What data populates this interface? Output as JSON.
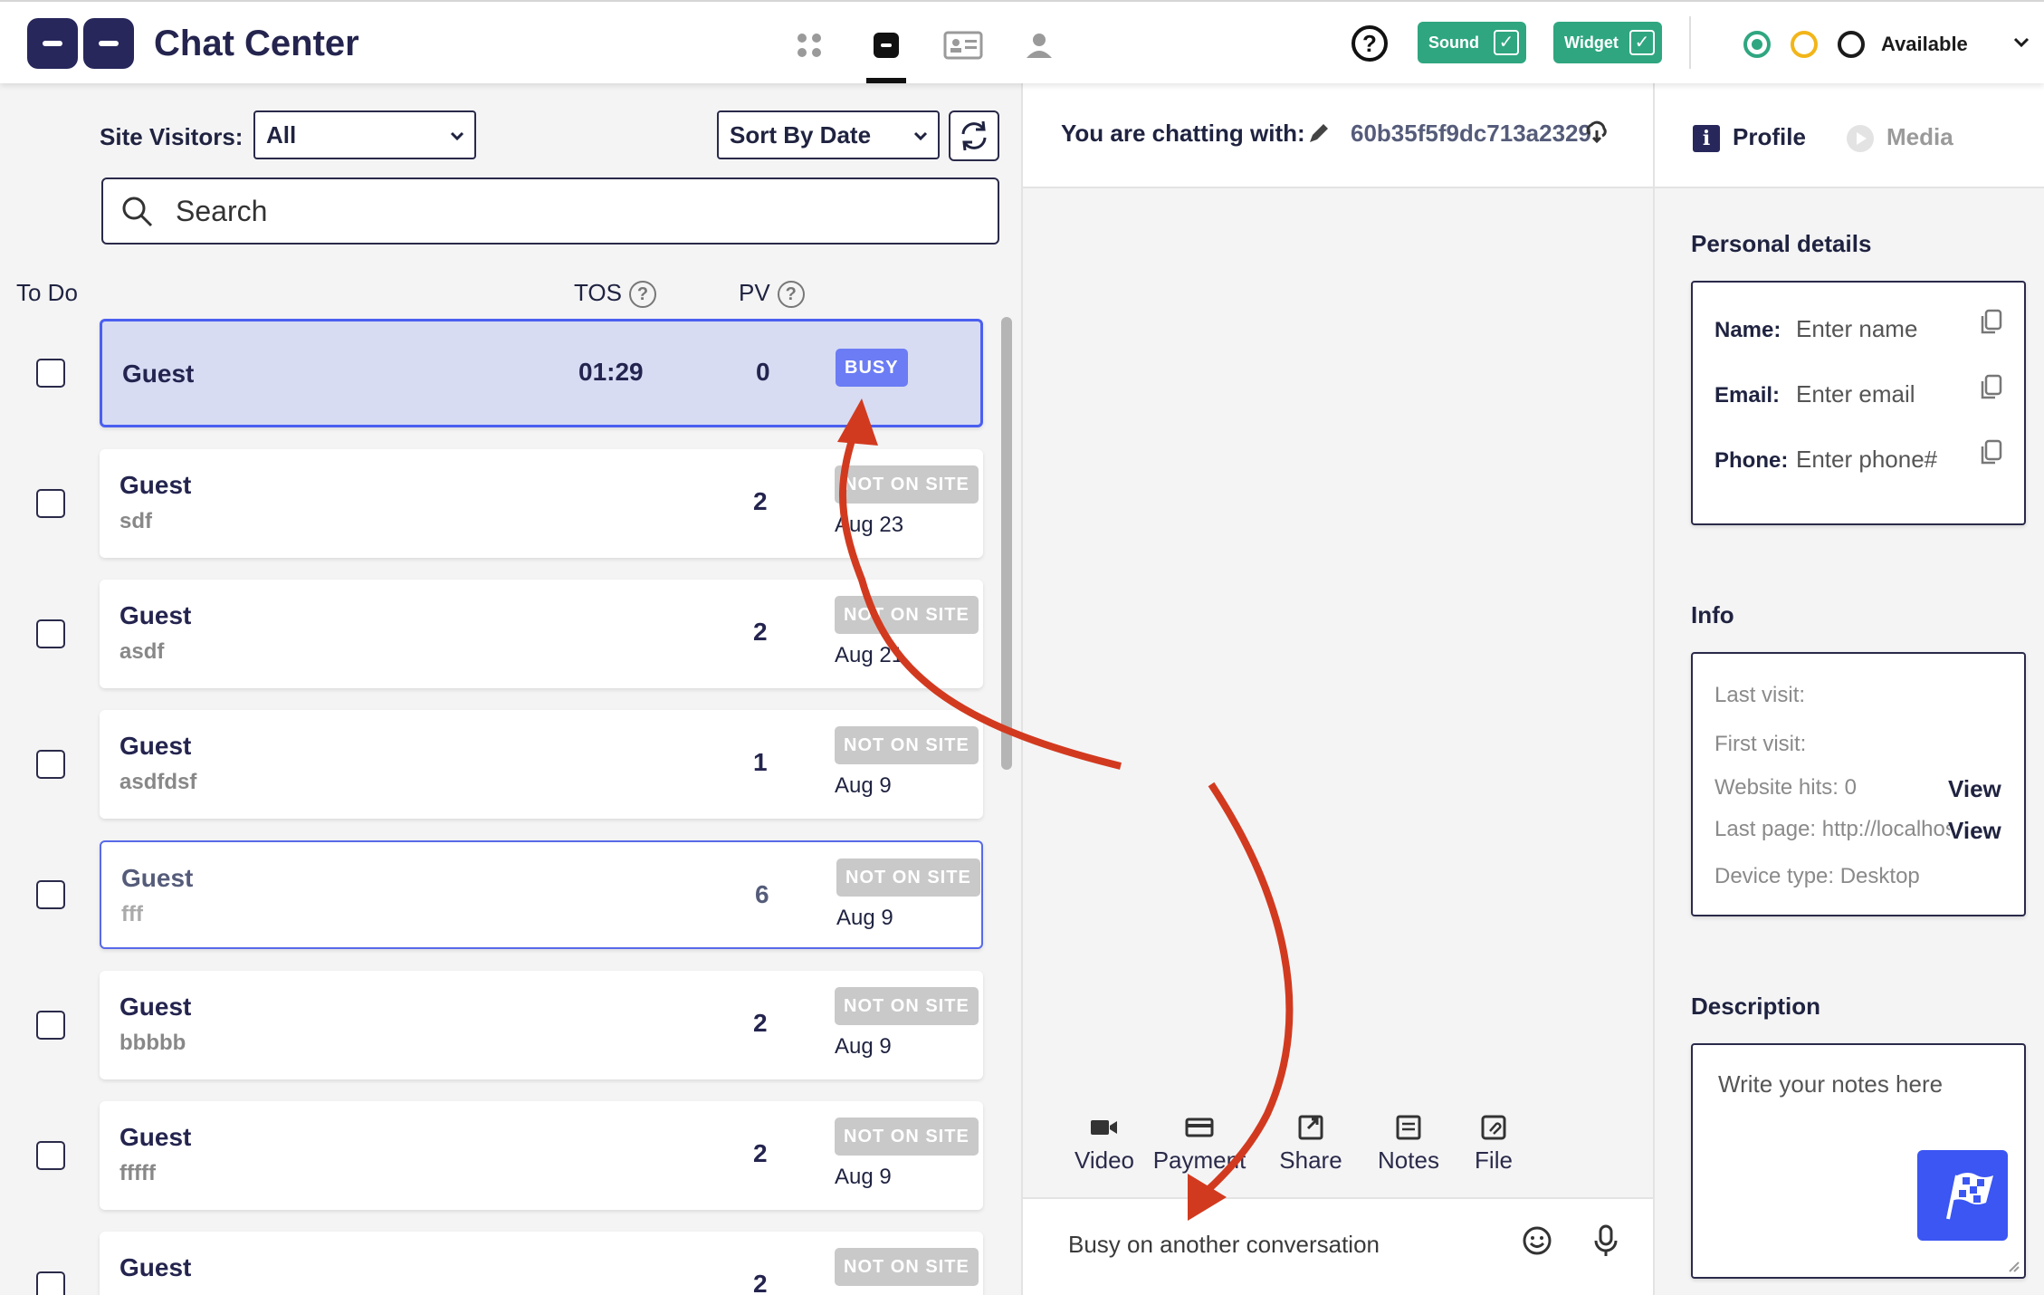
{
  "header": {
    "title": "Chat Center",
    "sound_label": "Sound",
    "widget_label": "Widget",
    "check_glyph": "✓",
    "help_glyph": "?",
    "status_label": "Available"
  },
  "left": {
    "visitors_label": "Site Visitors:",
    "visitors_filter": "All",
    "sort_filter": "Sort By Date",
    "search_placeholder": "Search",
    "col_todo": "To Do",
    "col_tos": "TOS",
    "col_pv": "PV",
    "help_glyph": "?",
    "rows": [
      {
        "name": "Guest",
        "sub": "",
        "tos": "01:29",
        "pv": "0",
        "badge": "BUSY",
        "date": ""
      },
      {
        "name": "Guest",
        "sub": "sdf",
        "tos": "",
        "pv": "2",
        "badge": "NOT ON SITE",
        "date": "Aug 23"
      },
      {
        "name": "Guest",
        "sub": "asdf",
        "tos": "",
        "pv": "2",
        "badge": "NOT ON SITE",
        "date": "Aug 21"
      },
      {
        "name": "Guest",
        "sub": "asdfdsf",
        "tos": "",
        "pv": "1",
        "badge": "NOT ON SITE",
        "date": "Aug 9"
      },
      {
        "name": "Guest",
        "sub": "fff",
        "tos": "",
        "pv": "6",
        "badge": "NOT ON SITE",
        "date": "Aug 9"
      },
      {
        "name": "Guest",
        "sub": "bbbbb",
        "tos": "",
        "pv": "2",
        "badge": "NOT ON SITE",
        "date": "Aug 9"
      },
      {
        "name": "Guest",
        "sub": "fffff",
        "tos": "",
        "pv": "2",
        "badge": "NOT ON SITE",
        "date": "Aug 9"
      },
      {
        "name": "Guest",
        "sub": "",
        "tos": "",
        "pv": "2",
        "badge": "NOT ON SITE",
        "date": ""
      }
    ]
  },
  "chat": {
    "with_label": "You are chatting with:",
    "visitor_id": "60b35f5f9dc713a2329",
    "tools": [
      "Video",
      "Payment",
      "Share",
      "Notes",
      "File"
    ],
    "composer_placeholder": "Busy on another conversation"
  },
  "profile": {
    "tab_profile": "Profile",
    "tab_profile_icon": "i",
    "tab_media": "Media",
    "personal_title": "Personal details",
    "name_label": "Name:",
    "name_placeholder": "Enter name",
    "email_label": "Email:",
    "email_placeholder": "Enter email",
    "phone_label": "Phone:",
    "phone_placeholder": "Enter phone#",
    "info_title": "Info",
    "last_visit": "Last visit:",
    "first_visit": "First visit:",
    "website_hits": "Website hits: 0",
    "last_page": "Last page: http://localhost",
    "device_type": "Device type: Desktop",
    "view_label": "View",
    "description_title": "Description",
    "notes_placeholder": "Write your notes here"
  },
  "colors": {
    "brand": "#27275c",
    "accent_green": "#2fa680",
    "busy_badge": "#6b7cf4",
    "active_row": "#d7dcf3",
    "annotation_arrow": "#d23a1f",
    "flag_button": "#3b56f2"
  }
}
